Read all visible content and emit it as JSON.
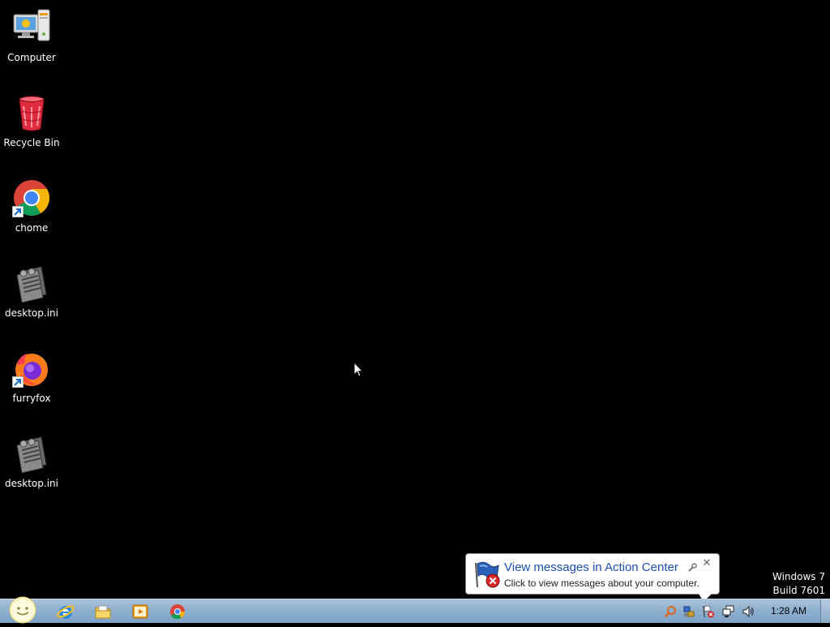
{
  "desktop": {
    "icons": [
      {
        "label": "Computer",
        "icon": "computer-icon"
      },
      {
        "label": "Recycle Bin",
        "icon": "recycle-bin-icon"
      },
      {
        "label": "chome",
        "icon": "chrome-shortcut-icon"
      },
      {
        "label": "desktop.ini",
        "icon": "settings-file-icon"
      },
      {
        "label": "furryfox",
        "icon": "firefox-shortcut-icon"
      },
      {
        "label": "desktop.ini",
        "icon": "settings-file-icon"
      }
    ],
    "watermark": {
      "line1": "Windows 7",
      "line2": "Build 7601"
    }
  },
  "notification": {
    "title": "View messages in Action Center",
    "text": "Click to view messages about your computer.",
    "icon": "action-center-flag-icon",
    "close_label": "✕"
  },
  "taskbar": {
    "pinned": [
      {
        "name": "internet-explorer",
        "icon": "internet-explorer-icon"
      },
      {
        "name": "windows-explorer",
        "icon": "folder-icon"
      },
      {
        "name": "media-player",
        "icon": "media-player-icon"
      },
      {
        "name": "chrome",
        "icon": "chrome-icon"
      }
    ],
    "tray": {
      "icons": [
        "search-icon",
        "network-settings-icon",
        "action-center-flag-icon",
        "network-icon",
        "volume-icon"
      ]
    },
    "clock": "1:28 AM"
  },
  "colors": {
    "desktop_background": "#000000",
    "taskbar": "#8fb0cf",
    "balloon_title": "#1f4fa8"
  }
}
